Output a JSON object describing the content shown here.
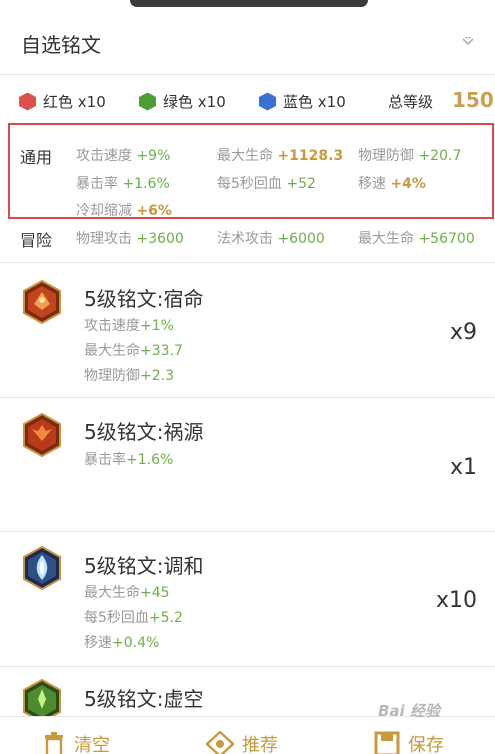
{
  "header": {
    "title": "自选铭文"
  },
  "counts": {
    "red": {
      "label": "红色 x10",
      "color": "#d9534a"
    },
    "green": {
      "label": "绿色 x10",
      "color": "#4e9b3a"
    },
    "blue": {
      "label": "蓝色 x10",
      "color": "#3a6fd4"
    },
    "level_label": "总等级",
    "level_value": "150"
  },
  "general": {
    "label": "通用",
    "rows": [
      [
        {
          "name": "攻击速度",
          "value": "+9%"
        },
        {
          "name": "最大生命",
          "value": "+1128.3"
        },
        {
          "name": "物理防御",
          "value": "+20.7"
        }
      ],
      [
        {
          "name": "暴击率",
          "value": "+1.6%"
        },
        {
          "name": "每5秒回血",
          "value": "+52"
        },
        {
          "name": "移速",
          "value": "+4%"
        }
      ],
      [
        {
          "name": "冷却缩减",
          "value": "+6%"
        }
      ]
    ]
  },
  "adventure": {
    "label": "冒险",
    "items": [
      {
        "name": "物理攻击",
        "value": "+3600"
      },
      {
        "name": "法术攻击",
        "value": "+6000"
      },
      {
        "name": "最大生命",
        "value": "+56700"
      }
    ]
  },
  "runes": [
    {
      "name": "5级铭文:宿命",
      "count": "x9",
      "stats": [
        {
          "name": "攻击速度",
          "value": "+1%"
        },
        {
          "name": "最大生命",
          "value": "+33.7"
        },
        {
          "name": "物理防御",
          "value": "+2.3"
        }
      ]
    },
    {
      "name": "5级铭文:祸源",
      "count": "x1",
      "stats": [
        {
          "name": "暴击率",
          "value": "+1.6%"
        }
      ]
    },
    {
      "name": "5级铭文:调和",
      "count": "x10",
      "stats": [
        {
          "name": "最大生命",
          "value": "+45"
        },
        {
          "name": "每5秒回血",
          "value": "+5.2"
        },
        {
          "name": "移速",
          "value": "+0.4%"
        }
      ]
    },
    {
      "name": "5级铭文:虚空"
    }
  ],
  "bottom": {
    "clear": "清空",
    "recommend": "推荐",
    "save": "保存"
  },
  "watermark": "Bai 经验"
}
